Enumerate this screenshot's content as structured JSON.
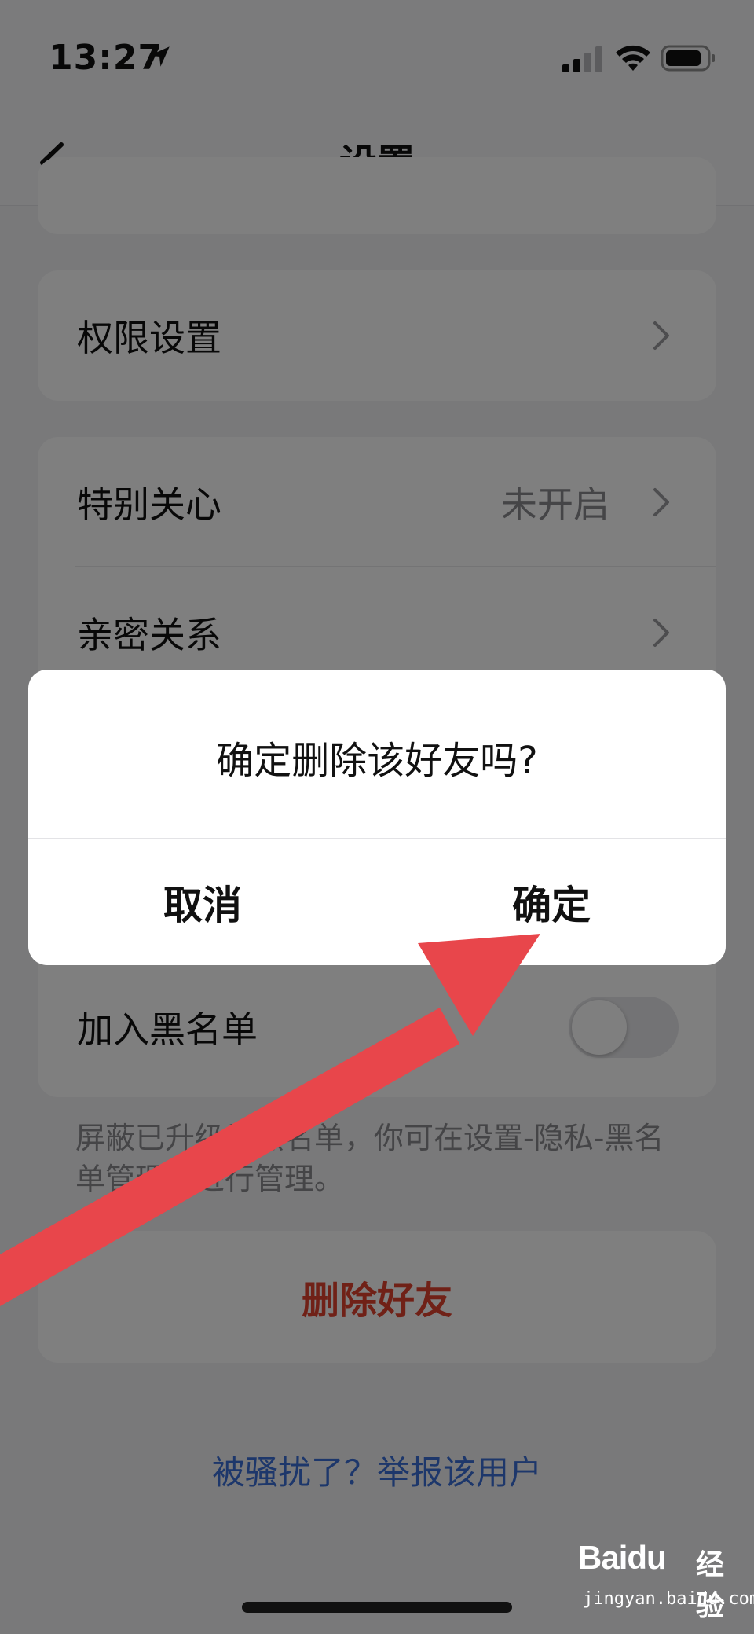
{
  "status_bar": {
    "time": "13:27"
  },
  "nav": {
    "title": "设置"
  },
  "sections": {
    "permission": {
      "label": "权限设置"
    },
    "special_care": {
      "label": "特别关心",
      "value": "未开启"
    },
    "intimacy": {
      "label": "亲密关系"
    },
    "blacklist": {
      "label": "加入黑名单",
      "enabled": false
    },
    "blacklist_note": "屏蔽已升级为黑名单，你可在设置-隐私-黑名单管理中进行管理。",
    "delete_friend": {
      "label": "删除好友"
    },
    "report_link": "被骚扰了？举报该用户"
  },
  "dialog": {
    "message": "确定删除该好友吗?",
    "cancel_label": "取消",
    "confirm_label": "确定"
  },
  "watermark": {
    "brand": "Baidu",
    "brand_cn": "经验",
    "url": "jingyan.baidu.com"
  },
  "colors": {
    "danger": "#e0432f",
    "link": "#3a6ed6",
    "annotation_arrow": "#e8464b"
  }
}
